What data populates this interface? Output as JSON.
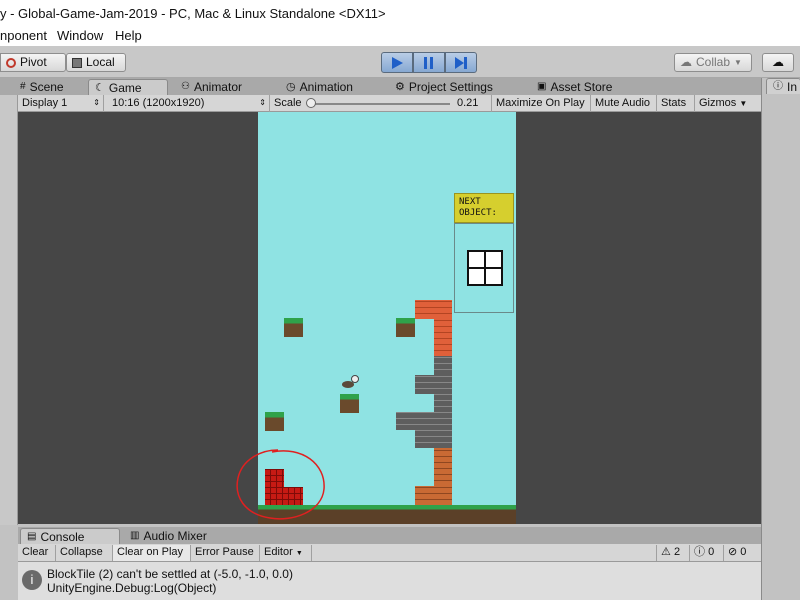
{
  "window": {
    "title": "y - Global-Game-Jam-2019 - PC, Mac & Linux Standalone <DX11>"
  },
  "menu": [
    "nponent",
    "Window",
    "Help"
  ],
  "toolbar": {
    "pivot_label": "Pivot",
    "local_label": "Local",
    "collab_label": "Collab",
    "accent": "#3a78d8"
  },
  "tabs": [
    {
      "label": "Scene",
      "icon": "scene-icon"
    },
    {
      "label": "Game",
      "icon": "game-icon",
      "active": true
    },
    {
      "label": "Animator",
      "icon": "animator-icon"
    },
    {
      "label": "Animation",
      "icon": "animation-icon"
    },
    {
      "label": "Project Settings",
      "icon": "settings-icon"
    },
    {
      "label": "Asset Store",
      "icon": "asset-store-icon"
    }
  ],
  "right_tab": "In",
  "gamebar": {
    "display": "Display 1",
    "resolution": "10:16 (1200x1920)",
    "scale_label": "Scale",
    "scale_value": "0.21",
    "maximize": "Maximize On Play",
    "mute": "Mute Audio",
    "stats": "Stats",
    "gizmos": "Gizmos"
  },
  "game": {
    "next_object_label": "NEXT\nOBJECT:",
    "sky_color": "#8fe3e3"
  },
  "console": {
    "tab_console": "Console",
    "tab_audio": "Audio Mixer",
    "clear": "Clear",
    "collapse": "Collapse",
    "clear_on_play": "Clear on Play",
    "error_pause": "Error Pause",
    "editor": "Editor",
    "warn_count": "2",
    "info_count": "0",
    "error_count": "0",
    "message_line1": "BlockTile (2) can't be settled at (-5.0, -1.0, 0.0)",
    "message_line2": "UnityEngine.Debug:Log(Object)"
  }
}
